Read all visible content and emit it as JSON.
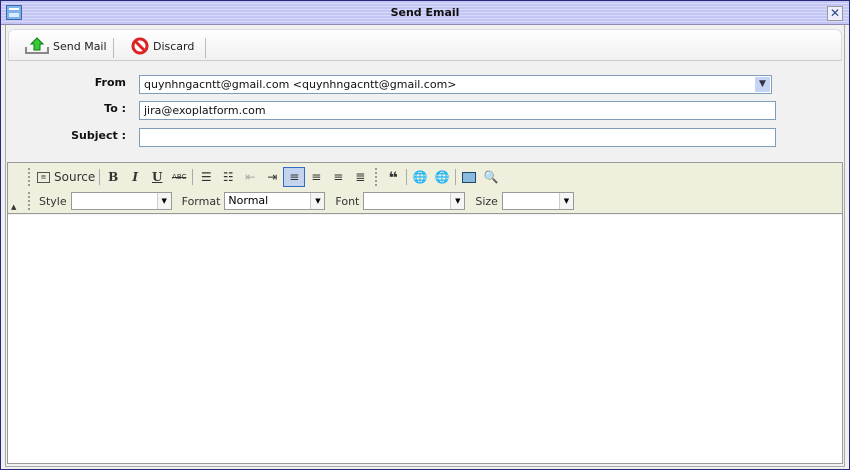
{
  "window": {
    "title": "Send Email"
  },
  "actions": {
    "send": "Send Mail",
    "discard": "Discard"
  },
  "form": {
    "from_label": "From",
    "from_value": "quynhngacntt@gmail.com <quynhngacntt@gmail.com>",
    "to_label": "To :",
    "to_value": "jira@exoplatform.com",
    "subject_label": "Subject :",
    "subject_value": ""
  },
  "editor": {
    "source": "Source",
    "bold": "B",
    "italic": "I",
    "underline": "U",
    "strike": "ABC",
    "style_label": "Style",
    "style_value": "",
    "format_label": "Format",
    "format_value": "Normal",
    "font_label": "Font",
    "font_value": "",
    "size_label": "Size",
    "size_value": "",
    "body": ""
  }
}
